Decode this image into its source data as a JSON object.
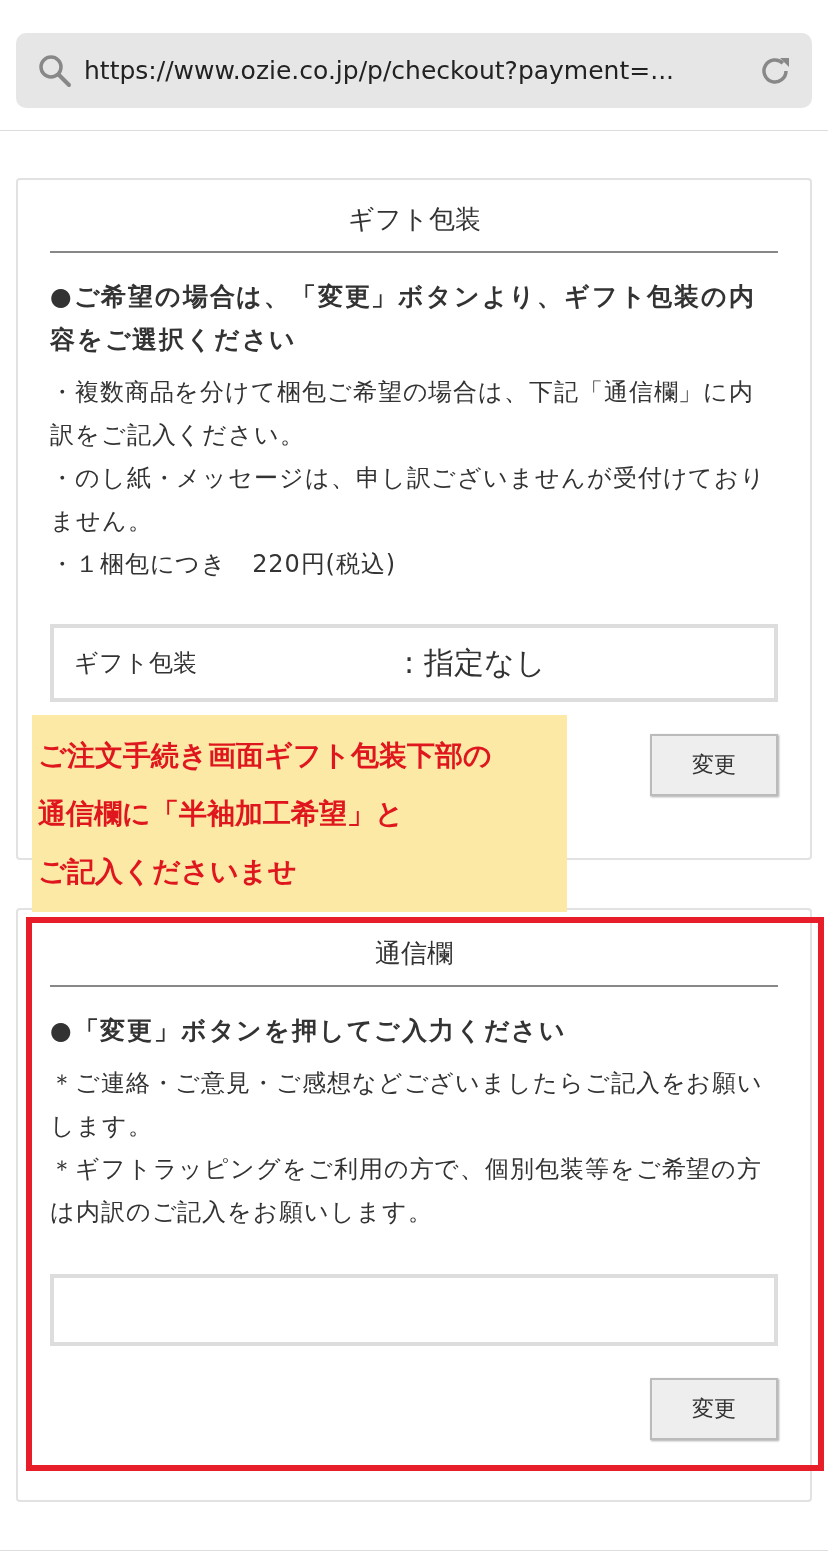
{
  "address_bar": {
    "url": "https://www.ozie.co.jp/p/checkout?payment=..."
  },
  "gift_section": {
    "title": "ギフト包装",
    "heading": "●ご希望の場合は、「変更」ボタンより、ギフト包装の内容をご選択ください",
    "notes": [
      "・複数商品を分けて梱包ご希望の場合は、下記「通信欄」に内訳をご記入ください。",
      "・のし紙・メッセージは、申し訳ございませんが受付けておりません。",
      "・１梱包につき　220円(税込)"
    ],
    "field": {
      "label": "ギフト包装",
      "value": ":  指定なし"
    },
    "button": "変更"
  },
  "annotation_note": [
    "ご注文手続き画面ギフト包装下部の",
    "通信欄に「半袖加工希望」と",
    "ご記入くださいませ"
  ],
  "message_section": {
    "title": "通信欄",
    "heading": "●「変更」ボタンを押してご入力ください",
    "notes": [
      "＊ご連絡・ご意見・ご感想などございましたらご記入をお願いします。",
      "＊ギフトラッピングをご利用の方で、個別包装等をご希望の方は内訳のご記入をお願いします。"
    ],
    "button": "変更",
    "highlighted": true
  }
}
